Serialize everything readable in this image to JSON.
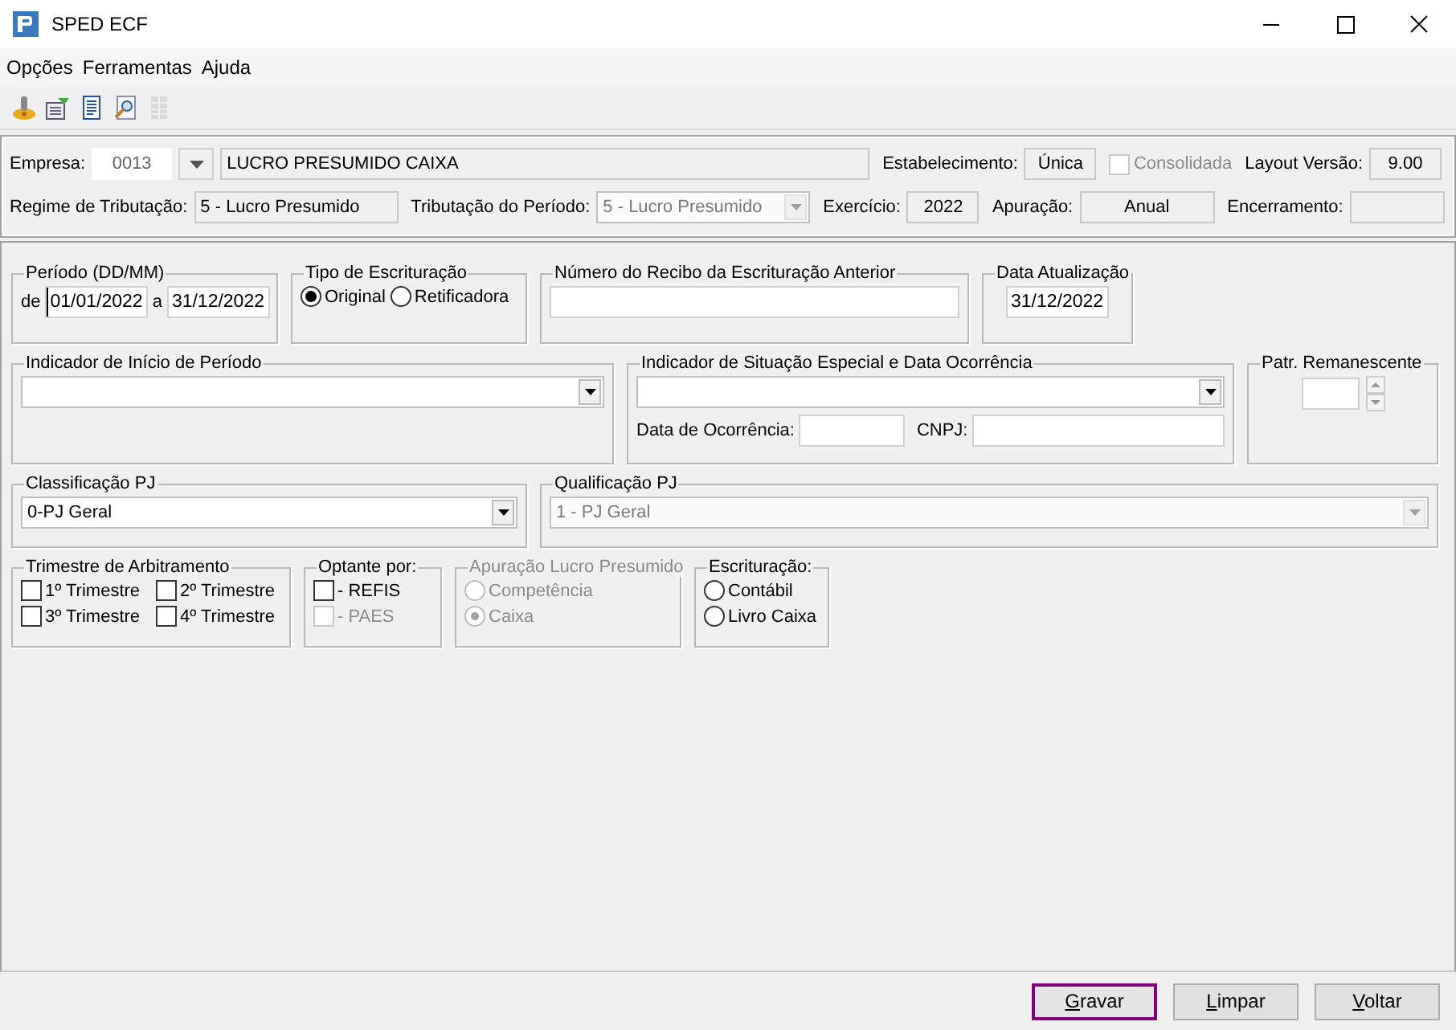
{
  "window": {
    "title": "SPED ECF"
  },
  "menu": [
    {
      "label": "Opções"
    },
    {
      "label": "Ferramentas"
    },
    {
      "label": "Ajuda"
    }
  ],
  "toolbar": [
    {
      "kind": "key",
      "disabled": false
    },
    {
      "kind": "settings",
      "disabled": false
    },
    {
      "kind": "document",
      "disabled": false
    },
    {
      "kind": "preview",
      "disabled": false
    },
    {
      "kind": "grid",
      "disabled": true
    }
  ],
  "header": {
    "empresa": {
      "label": "Empresa:",
      "code": "0013",
      "name": "LUCRO PRESUMIDO CAIXA"
    },
    "estabelecimento": {
      "label": "Estabelecimento:",
      "value": "Única"
    },
    "consolidada": {
      "label": "Consolidada",
      "checked": false,
      "disabled": true
    },
    "layout_versao": {
      "label": "Layout Versão:",
      "value": "9.00"
    },
    "regime": {
      "label": "Regime de Tributação:",
      "value": "5 - Lucro Presumido"
    },
    "tributacao_periodo": {
      "label": "Tributação do Período:",
      "value": "5 - Lucro Presumido",
      "disabled": true
    },
    "exercicio": {
      "label": "Exercício:",
      "value": "2022"
    },
    "apuracao": {
      "label": "Apuração:",
      "value": "Anual"
    },
    "encerramento": {
      "label": "Encerramento:"
    }
  },
  "periodo": {
    "title": "Período (DD/MM)",
    "from_label": "de",
    "from": "01/01/2022",
    "to_label": "a",
    "to": "31/12/2022"
  },
  "tipo": {
    "title": "Tipo de Escrituração",
    "options": [
      {
        "label": "Original",
        "selected": true
      },
      {
        "label": "Retificadora",
        "selected": false
      }
    ]
  },
  "recibo": {
    "title": "Número do Recibo da Escrituração Anterior"
  },
  "data_atualizacao": {
    "title": "Data Atualização",
    "value": "31/12/2022"
  },
  "inicio_periodo": {
    "title": "Indicador de Início de Período"
  },
  "situacao_especial": {
    "title": "Indicador de Situação Especial e Data Ocorrência",
    "data_label": "Data de Ocorrência:",
    "cnpj_label": "CNPJ:"
  },
  "patr_remanescente": {
    "title": "Patr. Remanescente"
  },
  "classificacao": {
    "title": "Classificação PJ",
    "value": "0-PJ Geral",
    "disabled": false
  },
  "qualificacao": {
    "title": "Qualificação PJ",
    "value": "1 - PJ Geral",
    "disabled": true
  },
  "trimestre": {
    "title": "Trimestre de Arbitramento",
    "options": [
      {
        "label": "1º Trimestre",
        "checked": false
      },
      {
        "label": "2º Trimestre",
        "checked": false
      },
      {
        "label": "3º Trimestre",
        "checked": false
      },
      {
        "label": "4º Trimestre",
        "checked": false
      }
    ]
  },
  "optante": {
    "title": "Optante por:",
    "options": [
      {
        "label": "- REFIS",
        "checked": false,
        "disabled": false
      },
      {
        "label": "- PAES",
        "checked": false,
        "disabled": true
      }
    ]
  },
  "apuracao_lp": {
    "title": "Apuração Lucro Presumido",
    "disabled": true,
    "options": [
      {
        "label": "Competência",
        "selected": false
      },
      {
        "label": "Caixa",
        "selected": true
      }
    ]
  },
  "escrituracao": {
    "title": "Escrituração:",
    "disabled": false,
    "options": [
      {
        "label": "Contábil",
        "selected": false
      },
      {
        "label": "Livro Caixa",
        "selected": false
      }
    ]
  },
  "buttons": [
    {
      "label": "Gravar",
      "focused": true
    },
    {
      "label": "Limpar",
      "focused": false
    },
    {
      "label": "Voltar",
      "focused": false
    }
  ]
}
